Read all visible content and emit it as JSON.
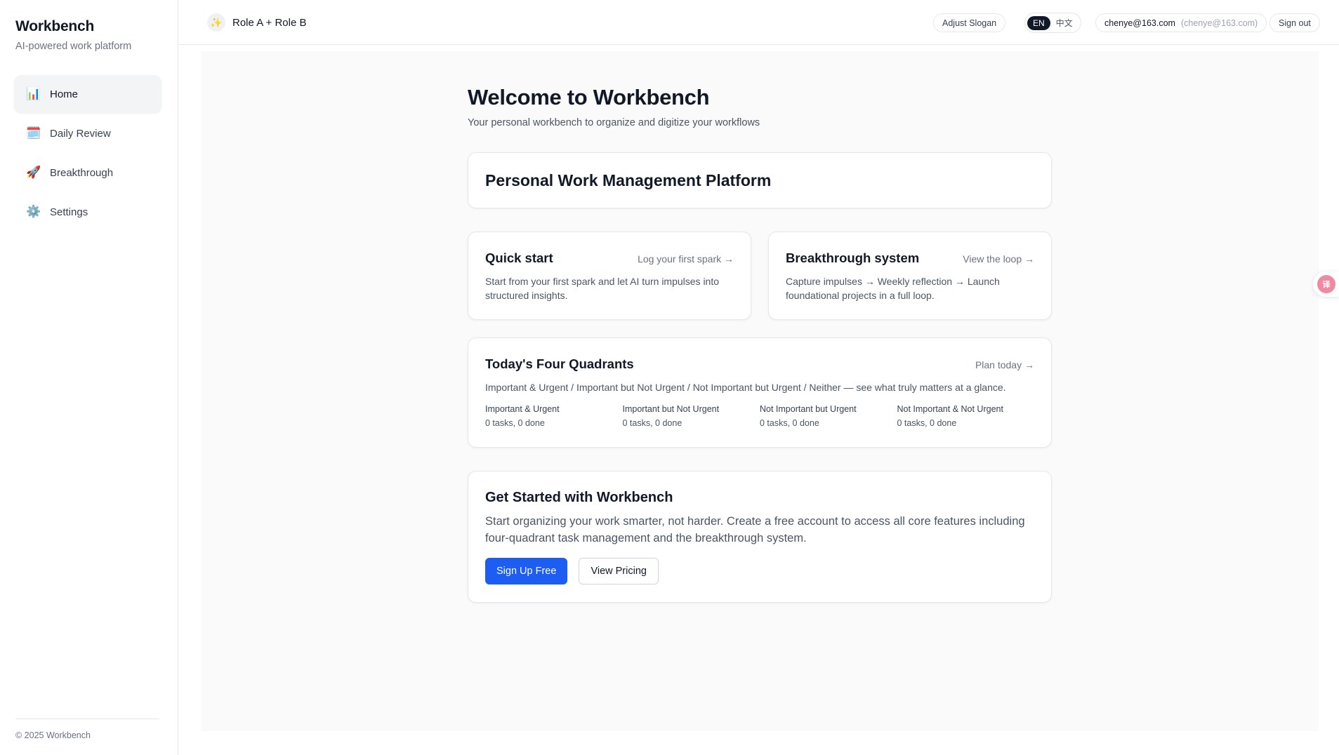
{
  "sidebar": {
    "brand_title": "Workbench",
    "brand_subtitle": "AI-powered work platform",
    "items": [
      {
        "label": "Home",
        "icon": "bar-chart-icon",
        "glyph": "📊",
        "active": true
      },
      {
        "label": "Daily Review",
        "icon": "calendar-icon",
        "glyph": "🗓️",
        "active": false
      },
      {
        "label": "Breakthrough",
        "icon": "rocket-icon",
        "glyph": "🚀",
        "active": false
      },
      {
        "label": "Settings",
        "icon": "gear-icon",
        "glyph": "⚙️",
        "active": false
      }
    ],
    "footer": "© 2025 Workbench"
  },
  "header": {
    "role_icon": "sparkle-icon",
    "role_glyph": "✨",
    "role_text": "Role A + Role B",
    "adjust_slogan": "Adjust Slogan",
    "lang_en": "EN",
    "lang_zh": "中文",
    "user_email": "chenye@163.com",
    "user_sub": "(chenye@163.com)",
    "sign_out": "Sign out"
  },
  "main": {
    "title": "Welcome to Workbench",
    "subtitle": "Your personal workbench to organize and digitize your workflows",
    "platform_title": "Personal Work Management Platform",
    "quick_start": {
      "title": "Quick start",
      "link": "Log your first spark →",
      "desc": "Start from your first spark and let AI turn impulses into structured insights."
    },
    "breakthrough": {
      "title": "Breakthrough system",
      "link": "View the loop →",
      "desc": "Capture impulses → Weekly reflection → Launch foundational projects in a full loop."
    },
    "quadrants": {
      "title": "Today's Four Quadrants",
      "link": "Plan today →",
      "desc": "Important & Urgent / Important but Not Urgent / Not Important but Urgent / Neither — see what truly matters at a glance.",
      "items": [
        {
          "name": "Important & Urgent",
          "stat": "0 tasks, 0 done"
        },
        {
          "name": "Important but Not Urgent",
          "stat": "0 tasks, 0 done"
        },
        {
          "name": "Not Important but Urgent",
          "stat": "0 tasks, 0 done"
        },
        {
          "name": "Not Important & Not Urgent",
          "stat": "0 tasks, 0 done"
        }
      ]
    },
    "get_started": {
      "title": "Get Started with Workbench",
      "desc": "Start organizing your work smarter, not harder. Create a free account to access all core features including four-quadrant task management and the breakthrough system.",
      "primary_button": "Sign Up Free",
      "secondary_button": "View Pricing"
    }
  },
  "floating_widget": {
    "icon": "translate-icon",
    "glyph": "译"
  },
  "colors": {
    "accent": "#1d5df2",
    "text": "#111827",
    "muted": "#6b7280",
    "background": "#fafafa"
  }
}
